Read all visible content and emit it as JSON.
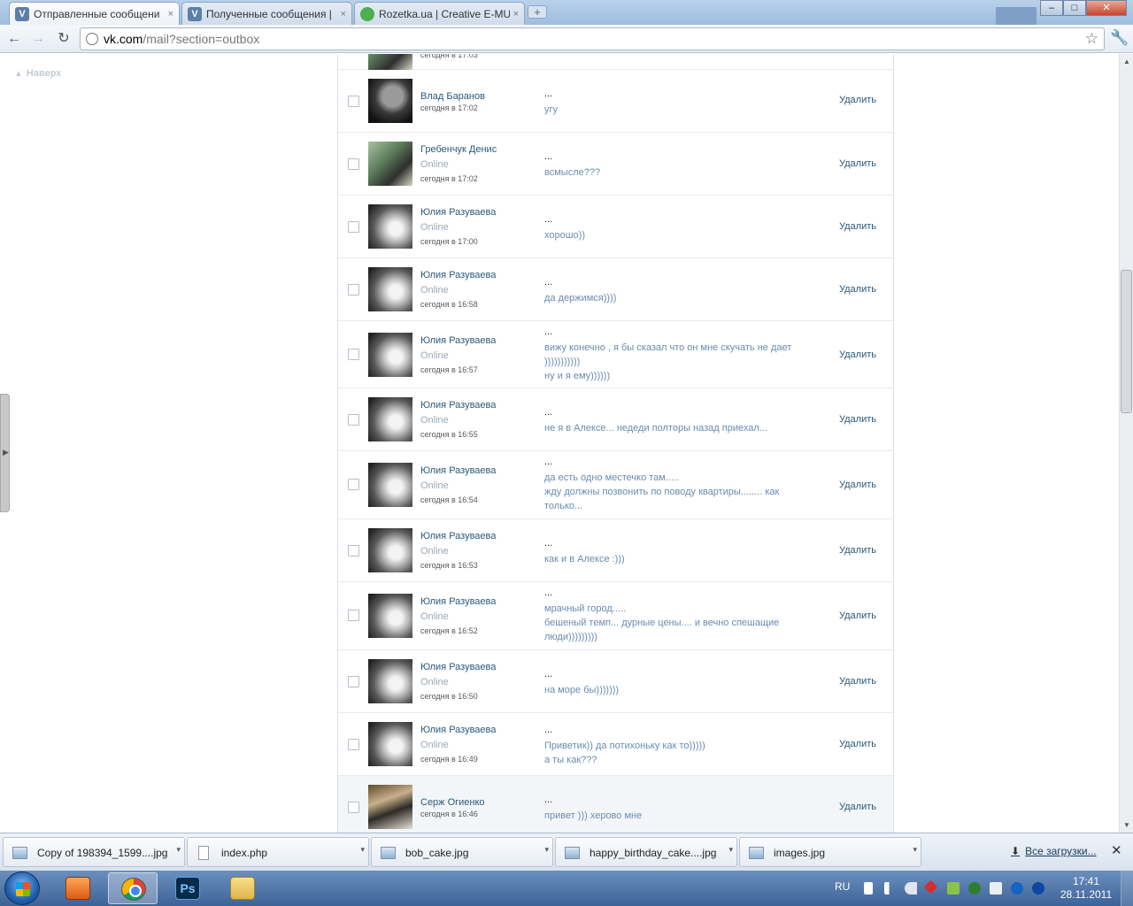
{
  "tabs": [
    {
      "title": "Отправленные сообщени",
      "icon": "V"
    },
    {
      "title": "Полученные сообщения |",
      "icon": "V"
    },
    {
      "title": "Rozetka.ua | Creative E-MU",
      "icon": ""
    }
  ],
  "tab_close": "×",
  "new_tab": "+",
  "window_controls": {
    "minimize": "–",
    "maximize": "□",
    "close": "✕"
  },
  "toolbar": {
    "back": "←",
    "forward": "→",
    "reload": "↻",
    "wrench": "🔧"
  },
  "address": {
    "host": "vk.com",
    "path": "/mail?section=outbox",
    "star": "☆"
  },
  "page": {
    "up_link": "Наверх",
    "up_arrow": "▲",
    "top_cut_time": "сегодня в 17:03",
    "messages": [
      {
        "name": "Влад Баранов",
        "online": "",
        "time": "сегодня в 17:02",
        "dots": "...",
        "lines": [
          "угу"
        ],
        "delete": "Удалить"
      },
      {
        "name": "Гребенчук Денис",
        "online": "Online",
        "time": "сегодня в 17:02",
        "dots": "...",
        "lines": [
          "всмысле???"
        ],
        "delete": "Удалить"
      },
      {
        "name": "Юлия Разуваева",
        "online": "Online",
        "time": "сегодня в 17:00",
        "dots": "...",
        "lines": [
          "хорошо))"
        ],
        "delete": "Удалить"
      },
      {
        "name": "Юлия Разуваева",
        "online": "Online",
        "time": "сегодня в 16:58",
        "dots": "...",
        "lines": [
          "да держимся))))"
        ],
        "delete": "Удалить"
      },
      {
        "name": "Юлия Разуваева",
        "online": "Online",
        "time": "сегодня в 16:57",
        "dots": "...",
        "lines": [
          "вижу конечно , я бы сказал что он мне скучать не дает",
          ")))))))))))",
          "ну и я ему))))))"
        ],
        "delete": "Удалить"
      },
      {
        "name": "Юлия Разуваева",
        "online": "Online",
        "time": "сегодня в 16:55",
        "dots": "...",
        "lines": [
          "не я в Алексе... недеди полторы назад приехал..."
        ],
        "delete": "Удалить"
      },
      {
        "name": "Юлия Разуваева",
        "online": "Online",
        "time": "сегодня в 16:54",
        "dots": "...",
        "lines": [
          "да есть одно местечко там.....",
          "жду должны позвонить по поводу квартиры........ как",
          "только..."
        ],
        "delete": "Удалить"
      },
      {
        "name": "Юлия Разуваева",
        "online": "Online",
        "time": "сегодня в 16:53",
        "dots": "...",
        "lines": [
          "как и в Алексе :)))"
        ],
        "delete": "Удалить"
      },
      {
        "name": "Юлия Разуваева",
        "online": "Online",
        "time": "сегодня в 16:52",
        "dots": "...",
        "lines": [
          "мрачный город.....",
          "бешеный темп... дурные цены.... и вечно спешащие",
          "люди)))))))))"
        ],
        "delete": "Удалить"
      },
      {
        "name": "Юлия Разуваева",
        "online": "Online",
        "time": "сегодня в 16:50",
        "dots": "...",
        "lines": [
          "на море бы)))))))"
        ],
        "delete": "Удалить"
      },
      {
        "name": "Юлия Разуваева",
        "online": "Online",
        "time": "сегодня в 16:49",
        "dots": "...",
        "lines": [
          "Приветик)) да потихоньку как то)))))",
          "а ты как???"
        ],
        "delete": "Удалить"
      },
      {
        "name": "Серж Огиенко",
        "online": "",
        "time": "сегодня в 16:46",
        "dots": "...",
        "lines": [
          "привет ))) херово мне"
        ],
        "delete": "Удалить"
      }
    ]
  },
  "downloads": {
    "items": [
      "Copy of 198394_1599....jpg",
      "index.php",
      "bob_cake.jpg",
      "happy_birthday_cake....jpg",
      "images.jpg"
    ],
    "dropdown": "▾",
    "all_link": "Все загрузки...",
    "all_icon": "⬇",
    "close": "✕"
  },
  "taskbar": {
    "lang": "RU",
    "time": "17:41",
    "date": "28.11.2011",
    "ps_label": "Ps"
  }
}
